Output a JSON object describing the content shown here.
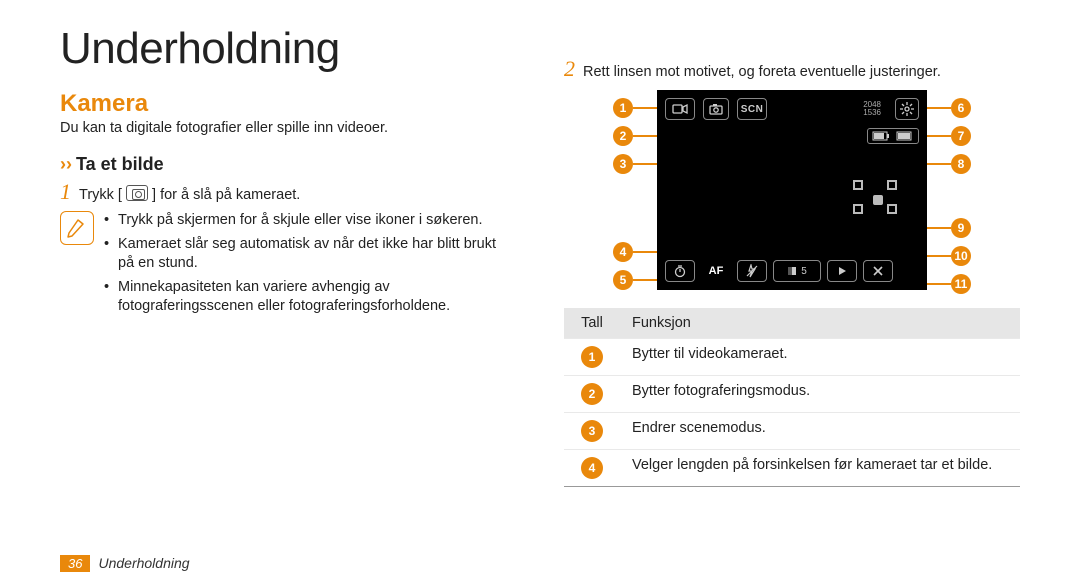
{
  "page": {
    "number": "36",
    "footer_section": "Underholdning"
  },
  "left": {
    "title": "Underholdning",
    "section": "Kamera",
    "intro": "Du kan ta digitale fotografier eller spille inn videoer.",
    "sub_heading": "Ta et bilde",
    "step1_num": "1",
    "step1_before": "Trykk [",
    "step1_after": "] for å slå på kameraet.",
    "bullets": [
      "Trykk på skjermen for å skjule eller vise ikoner i søkeren.",
      "Kameraet slår seg automatisk av når det ikke har blitt brukt på en stund.",
      "Minnekapasiteten kan variere avhengig av fotograferingsscenen eller fotograferingsforholdene."
    ]
  },
  "right": {
    "step2_num": "2",
    "step2_text": "Rett linsen mot motivet, og foreta eventuelle justeringer.",
    "screen": {
      "scn_label": "SCN",
      "resolution_top": "2048",
      "resolution_bottom": "1536",
      "af_label": "AF",
      "ev_value": "5"
    },
    "callouts": [
      "1",
      "2",
      "3",
      "4",
      "5",
      "6",
      "7",
      "8",
      "9",
      "10",
      "11"
    ],
    "table": {
      "head_num": "Tall",
      "head_fn": "Funksjon",
      "rows": [
        {
          "n": "1",
          "fn": "Bytter til videokameraet."
        },
        {
          "n": "2",
          "fn": "Bytter fotograferingsmodus."
        },
        {
          "n": "3",
          "fn": "Endrer scenemodus."
        },
        {
          "n": "4",
          "fn": "Velger lengden på forsinkelsen før kameraet tar et bilde."
        }
      ]
    }
  }
}
